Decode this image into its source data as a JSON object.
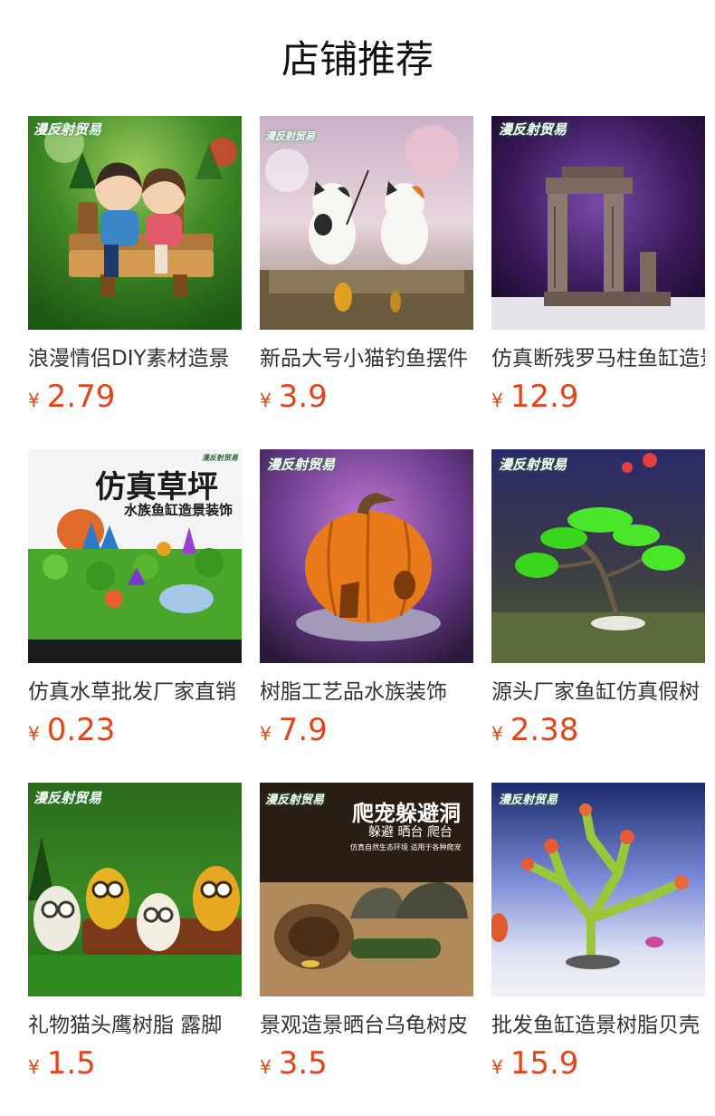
{
  "page": {
    "title": "店铺推荐"
  },
  "colors": {
    "price": "#e0461c",
    "title_text": "#333333",
    "heading_text": "#111111"
  },
  "products": [
    {
      "title": "浪漫情侣DIY素材造景",
      "currency": "¥",
      "price": "2.79",
      "image": "couple-on-bench-figurine",
      "watermark": "漫反射贸易"
    },
    {
      "title": "新品大号小猫钓鱼摆件",
      "currency": "¥",
      "price": "3.9",
      "image": "cats-fishing-figurine",
      "watermark": "漫反射贸易"
    },
    {
      "title": "仿真断残罗马柱鱼缸造景",
      "currency": "¥",
      "price": "12.9",
      "image": "roman-column-ruins-ornament",
      "watermark": "漫反射贸易"
    },
    {
      "title": "仿真水草批发厂家直销",
      "currency": "¥",
      "price": "0.23",
      "image": "artificial-grass-mat",
      "watermark": "漫反射贸易",
      "banner_title": "仿真草坪",
      "banner_subtitle": "水族鱼缸造景装饰"
    },
    {
      "title": "树脂工艺品水族装饰",
      "currency": "¥",
      "price": "7.9",
      "image": "pumpkin-house-ornament",
      "watermark": "漫反射贸易"
    },
    {
      "title": "源头厂家鱼缸仿真假树",
      "currency": "¥",
      "price": "2.38",
      "image": "bonsai-pine-tree-ornament",
      "watermark": "漫反射贸易"
    },
    {
      "title": "礼物猫头鹰树脂 露脚",
      "currency": "¥",
      "price": "1.5",
      "image": "owl-figurines",
      "watermark": "漫反射贸易"
    },
    {
      "title": "景观造景晒台乌龟树皮",
      "currency": "¥",
      "price": "3.5",
      "image": "reptile-hide-caves",
      "watermark": "漫反射贸易",
      "banner_title": "爬宠躲避洞",
      "banner_subtitle": "躲避 晒台 爬台",
      "banner_note": "仿真自然生态环境 适用于各种爬宠"
    },
    {
      "title": "批发鱼缸造景树脂贝壳",
      "currency": "¥",
      "price": "15.9",
      "image": "coral-branch-ornament",
      "watermark": "漫反射贸易"
    }
  ]
}
